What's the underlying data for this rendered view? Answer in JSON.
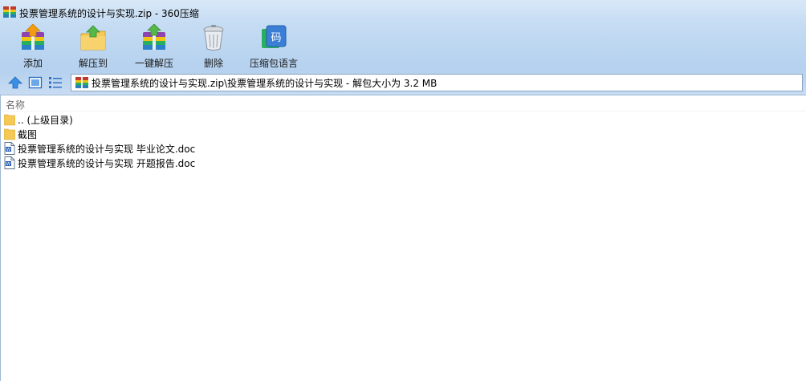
{
  "window": {
    "title": "投票管理系统的设计与实现.zip - 360压缩"
  },
  "toolbar": {
    "buttons": [
      {
        "label": "添加",
        "icon": "add-archive-icon"
      },
      {
        "label": "解压到",
        "icon": "extract-to-icon"
      },
      {
        "label": "一键解压",
        "icon": "one-click-extract-icon"
      },
      {
        "label": "删除",
        "icon": "trash-can-icon"
      },
      {
        "label": "压缩包语言",
        "icon": "archive-language-icon"
      }
    ]
  },
  "address_bar": {
    "path": "投票管理系统的设计与实现.zip\\投票管理系统的设计与实现 - 解包大小为 3.2 MB"
  },
  "file_list": {
    "column_name": "名称",
    "items": [
      {
        "label": ".. (上级目录)",
        "icon": "folder-icon"
      },
      {
        "label": "截图",
        "icon": "folder-icon"
      },
      {
        "label": "投票管理系统的设计与实现 毕业论文.doc",
        "icon": "word-doc-icon"
      },
      {
        "label": "投票管理系统的设计与实现 开题报告.doc",
        "icon": "word-doc-icon"
      }
    ]
  },
  "colors": {
    "chrome_top": "#d9e8f7",
    "chrome_bottom": "#b5d1ef",
    "address_border": "#8aa3c1",
    "folder": "#f5c956",
    "accent_blue": "#3a7fd5"
  }
}
